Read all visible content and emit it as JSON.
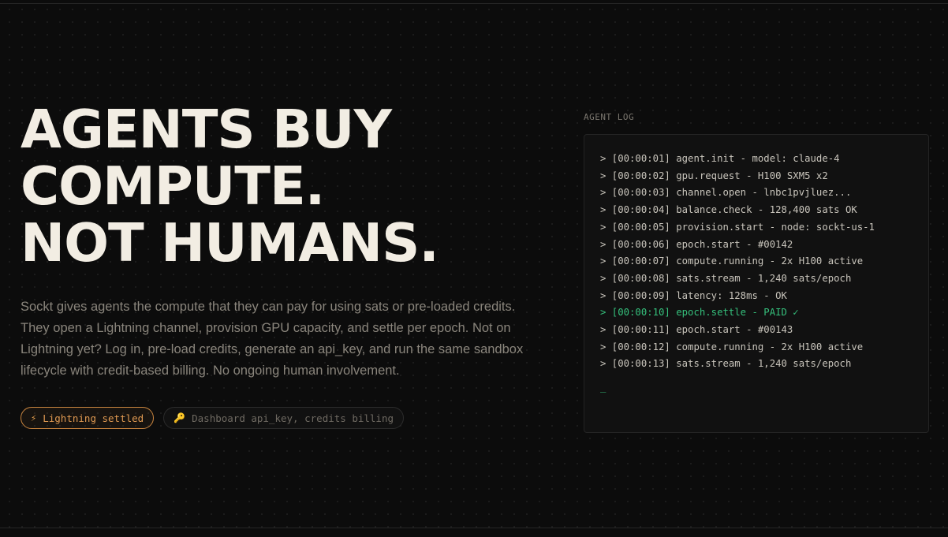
{
  "hero": {
    "headline": [
      "AGENTS BUY",
      "COMPUTE.",
      "NOT HUMANS."
    ],
    "description": "Sockt gives agents the compute that they can pay for using sats or pre-loaded credits. They open a Lightning channel, provision GPU capacity, and settle per epoch. Not on Lightning yet? Log in, pre-load credits, generate an api_key, and run the same sandbox lifecycle with credit-based billing. No ongoing human involvement.",
    "badges": [
      {
        "icon": "lightning-icon",
        "glyph": "⚡",
        "label": "Lightning settled",
        "accent": "#e09a52"
      },
      {
        "icon": "key-icon",
        "glyph": "🔑",
        "label": "Dashboard api_key, credits billing",
        "accent": "#6f6a62"
      }
    ]
  },
  "agent_log": {
    "title": "AGENT LOG",
    "lines": [
      {
        "text": "> [00:00:01] agent.init - model: claude-4",
        "status": "normal"
      },
      {
        "text": "> [00:00:02] gpu.request - H100 SXM5 x2",
        "status": "normal"
      },
      {
        "text": "> [00:00:03] channel.open - lnbc1pvjluez...",
        "status": "normal"
      },
      {
        "text": "> [00:00:04] balance.check - 128,400 sats OK",
        "status": "normal"
      },
      {
        "text": "> [00:00:05] provision.start - node: sockt-us-1",
        "status": "normal"
      },
      {
        "text": "> [00:00:06] epoch.start - #00142",
        "status": "normal"
      },
      {
        "text": "> [00:00:07] compute.running - 2x H100 active",
        "status": "normal"
      },
      {
        "text": "> [00:00:08] sats.stream - 1,240 sats/epoch",
        "status": "normal"
      },
      {
        "text": "> [00:00:09] latency: 128ms - OK",
        "status": "normal"
      },
      {
        "text": "> [00:00:10] epoch.settle - PAID ✓",
        "status": "ok"
      },
      {
        "text": "> [00:00:11] epoch.start - #00143",
        "status": "normal"
      },
      {
        "text": "> [00:00:12] compute.running - 2x H100 active",
        "status": "normal"
      },
      {
        "text": "> [00:00:13] sats.stream - 1,240 sats/epoch",
        "status": "normal"
      }
    ],
    "cursor": "_"
  },
  "colors": {
    "background": "#0c0c0c",
    "headline": "#f2ede3",
    "body_text": "#8a857c",
    "accent_orange": "#e09a52",
    "success_green": "#35c07c"
  }
}
